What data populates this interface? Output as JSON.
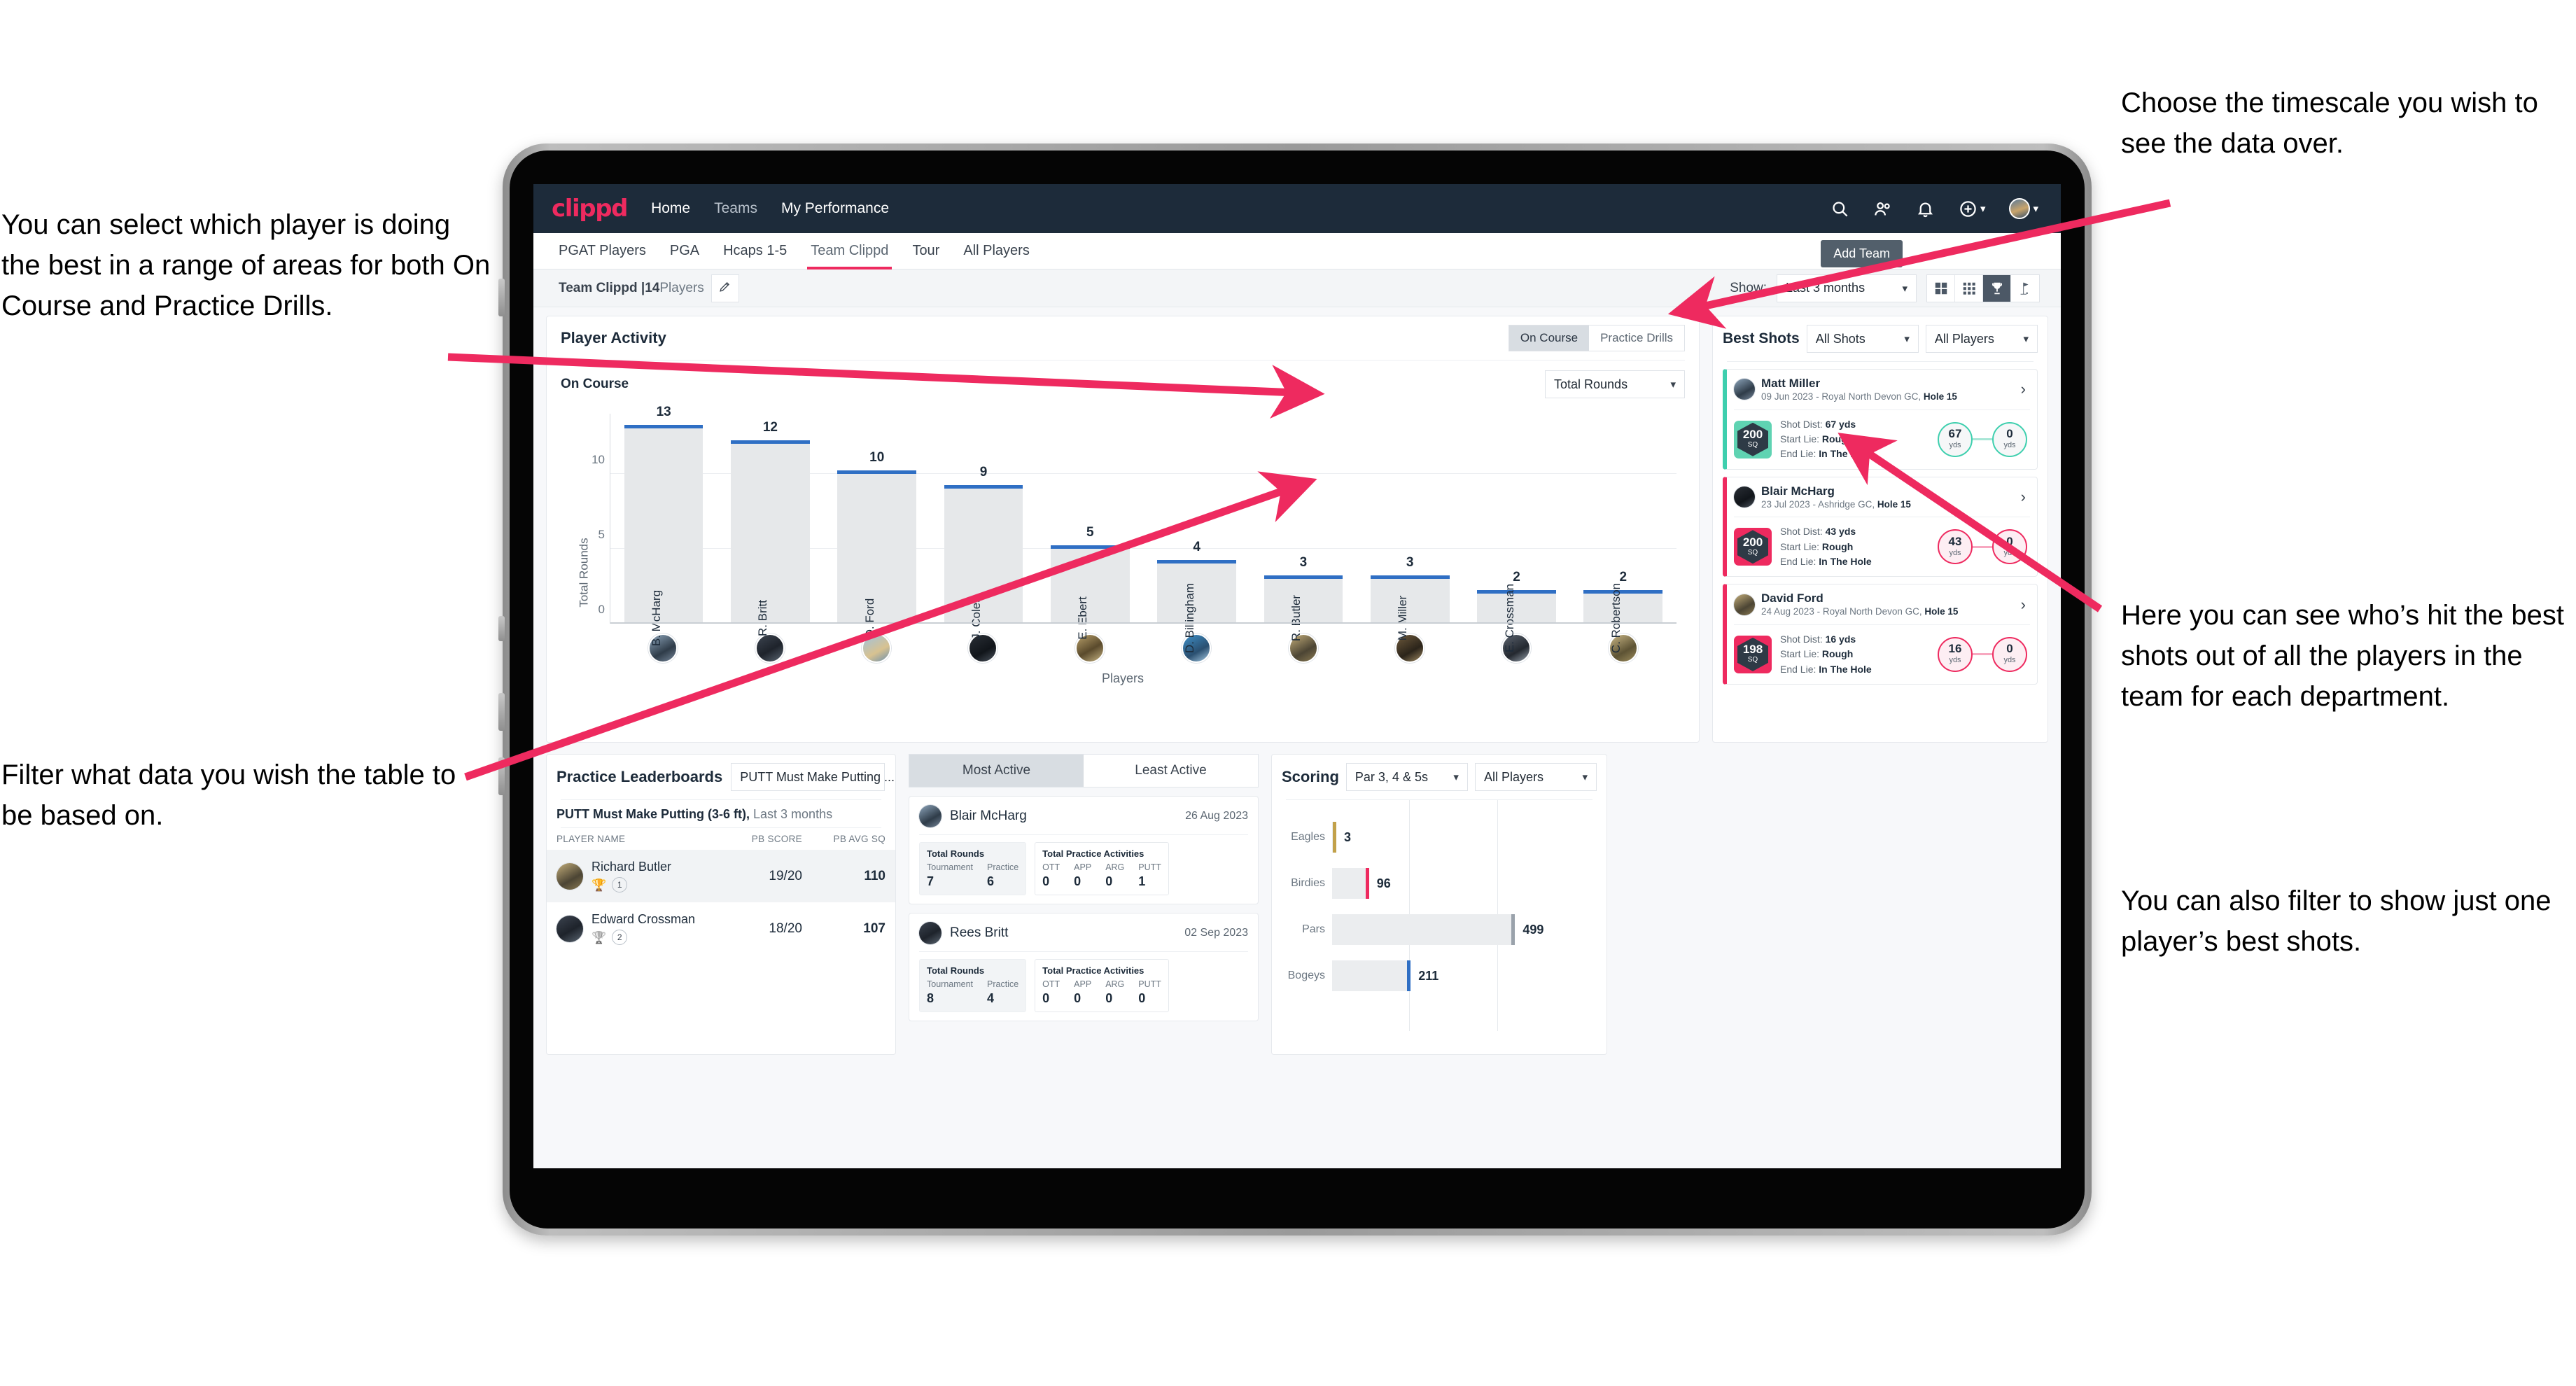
{
  "annotations": {
    "left_top": "You can select which player is doing the best in a range of areas for both On Course and Practice Drills.",
    "left_bottom": "Filter what data you wish the table to be based on.",
    "right_top": "Choose the timescale you wish to see the data over.",
    "right_middle": "Here you can see who’s hit the best shots out of all the players in the team for each department.",
    "right_bottom": "You can also filter to show just one player’s best shots."
  },
  "topnav": {
    "logo": "clippd",
    "links": [
      {
        "label": "Home",
        "active": true
      },
      {
        "label": "Teams",
        "active": false
      },
      {
        "label": "My Performance",
        "active": true
      }
    ],
    "icons": [
      "search-icon",
      "people-icon",
      "bell-icon",
      "plus-circle-icon",
      "avatar"
    ],
    "add_team_tooltip": "Add Team"
  },
  "tabs": [
    {
      "label": "PGAT Players",
      "active": false
    },
    {
      "label": "PGA",
      "active": false
    },
    {
      "label": "Hcaps 1-5",
      "active": false
    },
    {
      "label": "Team Clippd",
      "active": true
    },
    {
      "label": "Tour",
      "active": false
    },
    {
      "label": "All Players",
      "active": false
    }
  ],
  "subheader": {
    "team_name": "Team Clippd",
    "separator": "|",
    "player_count": "14",
    "players_word": "Players",
    "edit_icon": "pencil-icon",
    "show_label": "Show:",
    "timescale_value": "Last 3 months",
    "view_modes": [
      "grid-large-icon",
      "grid-small-icon",
      "trophy-icon",
      "flag-icon"
    ],
    "view_active_index": 2
  },
  "player_activity": {
    "title": "Player Activity",
    "segments": [
      {
        "label": "On Course",
        "active": true
      },
      {
        "label": "Practice Drills",
        "active": false
      }
    ],
    "sub_title": "On Course",
    "metric_select": "Total Rounds"
  },
  "chart_data": [
    {
      "type": "bar",
      "title": "Player Activity — On Course",
      "xlabel": "Players",
      "ylabel": "Total Rounds",
      "ylim": [
        0,
        14
      ],
      "yticks": [
        0,
        5,
        10
      ],
      "grid": true,
      "categories": [
        "B. McHarg",
        "R. Britt",
        "D. Ford",
        "J. Coles",
        "E. Ebert",
        "D. Billingham",
        "R. Butler",
        "M. Miller",
        "E. Crossman",
        "C. Robertson"
      ],
      "values": [
        13,
        12,
        10,
        9,
        5,
        4,
        3,
        3,
        2,
        2
      ]
    },
    {
      "type": "bar",
      "title": "Scoring",
      "orientation": "horizontal",
      "categories": [
        "Eagles",
        "Birdies",
        "Pars",
        "Bogeys"
      ],
      "values": [
        3,
        96,
        499,
        211
      ],
      "xlabel": "",
      "ylabel": "",
      "grid": true
    }
  ],
  "best_shots": {
    "title": "Best Shots",
    "shot_filter": "All Shots",
    "player_filter": "All Players",
    "cards": [
      {
        "name": "Matt Miller",
        "meta_date": "09 Jun 2023 - Royal North Devon GC,",
        "meta_hole": "Hole 15",
        "sq": "200",
        "sq_unit": "SQ",
        "accent": "#3ecfae",
        "shot_dist_label": "Shot Dist:",
        "shot_dist": "67 yds",
        "start_lie_label": "Start Lie:",
        "start_lie": "Rough",
        "end_lie_label": "End Lie:",
        "end_lie": "In The Hole",
        "from_value": "67",
        "from_unit": "yds",
        "to_value": "0",
        "to_unit": "yds"
      },
      {
        "name": "Blair McHarg",
        "meta_date": "23 Jul 2023 - Ashridge GC,",
        "meta_hole": "Hole 15",
        "sq": "200",
        "sq_unit": "SQ",
        "accent": "#ee2a5f",
        "shot_dist_label": "Shot Dist:",
        "shot_dist": "43 yds",
        "start_lie_label": "Start Lie:",
        "start_lie": "Rough",
        "end_lie_label": "End Lie:",
        "end_lie": "In The Hole",
        "from_value": "43",
        "from_unit": "yds",
        "to_value": "0",
        "to_unit": "yds"
      },
      {
        "name": "David Ford",
        "meta_date": "24 Aug 2023 - Royal North Devon GC,",
        "meta_hole": "Hole 15",
        "sq": "198",
        "sq_unit": "SQ",
        "accent": "#ee2a5f",
        "shot_dist_label": "Shot Dist:",
        "shot_dist": "16 yds",
        "start_lie_label": "Start Lie:",
        "start_lie": "Rough",
        "end_lie_label": "End Lie:",
        "end_lie": "In The Hole",
        "from_value": "16",
        "from_unit": "yds",
        "to_value": "0",
        "to_unit": "yds"
      }
    ]
  },
  "practice_leaderboards": {
    "title": "Practice Leaderboards",
    "select": "PUTT Must Make Putting ...",
    "sub_bold": "PUTT Must Make Putting (3-6 ft),",
    "sub_light": "Last 3 months",
    "columns": [
      "PLAYER NAME",
      "PB SCORE",
      "PB AVG SQ"
    ],
    "rows": [
      {
        "name": "Richard Butler",
        "rank": "1",
        "trophy": "gold",
        "pb_score": "19/20",
        "pb_avg_sq": "110"
      },
      {
        "name": "Edward Crossman",
        "rank": "2",
        "trophy": "silver",
        "pb_score": "18/20",
        "pb_avg_sq": "107"
      }
    ]
  },
  "activity": {
    "tabs": [
      {
        "label": "Most Active",
        "active": true
      },
      {
        "label": "Least Active",
        "active": false
      }
    ],
    "cards": [
      {
        "name": "Blair McHarg",
        "date": "26 Aug 2023",
        "rounds_title": "Total Rounds",
        "rounds": [
          {
            "key": "Tournament",
            "value": "7"
          },
          {
            "key": "Practice",
            "value": "6"
          }
        ],
        "practice_title": "Total Practice Activities",
        "practice": [
          {
            "key": "OTT",
            "value": "0"
          },
          {
            "key": "APP",
            "value": "0"
          },
          {
            "key": "ARG",
            "value": "0"
          },
          {
            "key": "PUTT",
            "value": "1"
          }
        ]
      },
      {
        "name": "Rees Britt",
        "date": "02 Sep 2023",
        "rounds_title": "Total Rounds",
        "rounds": [
          {
            "key": "Tournament",
            "value": "8"
          },
          {
            "key": "Practice",
            "value": "4"
          }
        ],
        "practice_title": "Total Practice Activities",
        "practice": [
          {
            "key": "OTT",
            "value": "0"
          },
          {
            "key": "APP",
            "value": "0"
          },
          {
            "key": "ARG",
            "value": "0"
          },
          {
            "key": "PUTT",
            "value": "0"
          }
        ]
      }
    ]
  },
  "scoring": {
    "title": "Scoring",
    "par_filter": "Par 3, 4 & 5s",
    "player_filter": "All Players",
    "rows": [
      {
        "label": "Eagles",
        "value": "3",
        "color": "gold"
      },
      {
        "label": "Birdies",
        "value": "96",
        "color": "pinkv"
      },
      {
        "label": "Pars",
        "value": "499",
        "color": "grey"
      },
      {
        "label": "Bogeys",
        "value": "211",
        "color": "blue"
      }
    ]
  }
}
